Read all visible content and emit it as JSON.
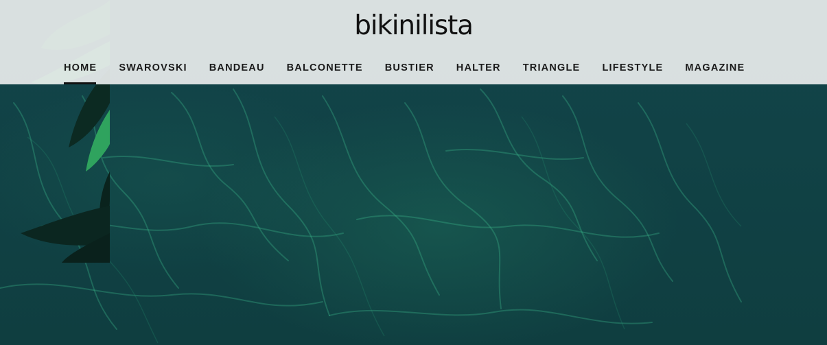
{
  "site": {
    "logo": "bikinilista"
  },
  "nav": {
    "items": [
      {
        "label": "HOME",
        "active": true
      },
      {
        "label": "SWAROVSKI",
        "active": false
      },
      {
        "label": "BANDEAU",
        "active": false
      },
      {
        "label": "BALCONETTE",
        "active": false
      },
      {
        "label": "BUSTIER",
        "active": false
      },
      {
        "label": "HALTER",
        "active": false
      },
      {
        "label": "TRIANGLE",
        "active": false
      },
      {
        "label": "LIFESTYLE",
        "active": false
      },
      {
        "label": "MAGAZINE",
        "active": false
      }
    ]
  },
  "hero": {
    "image": "pool-water-with-tropical-leaves"
  },
  "colors": {
    "header_bg": "#e8ecec",
    "water": "#114246",
    "caustics": "#3fbf8f",
    "leaf": "#1f8a4c",
    "text": "#1a1a1a"
  }
}
